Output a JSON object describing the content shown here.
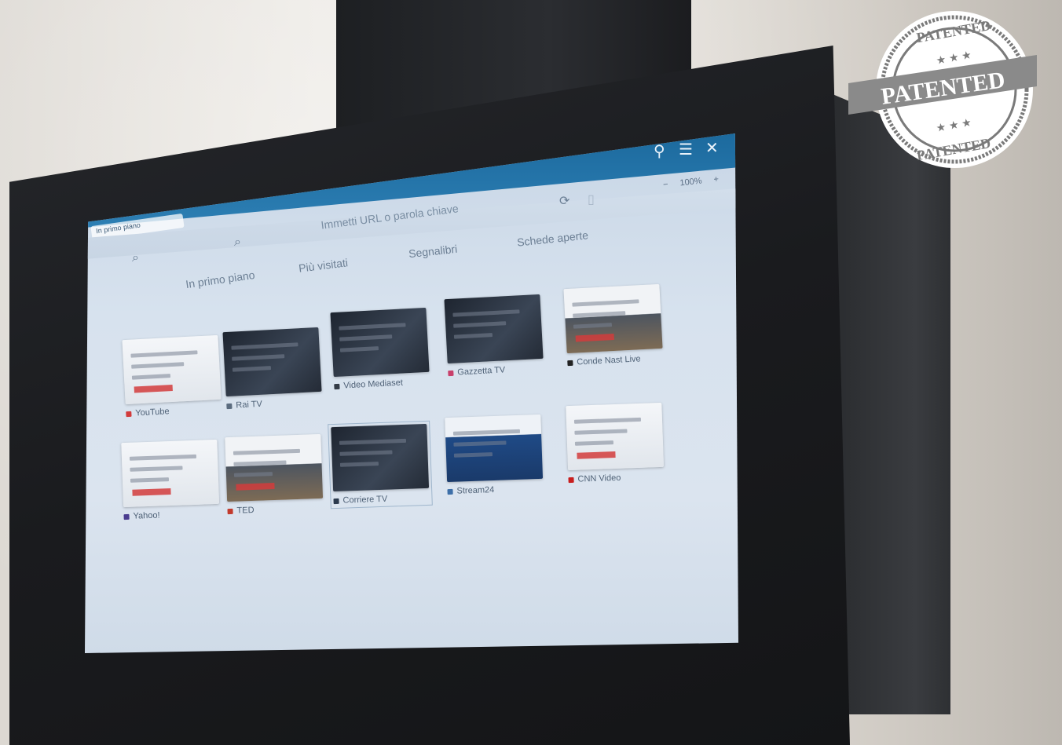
{
  "browser": {
    "active_tab": "In primo piano",
    "address_placeholder": "Immetti URL o parola chiave",
    "zoom_minus": "−",
    "zoom_level": "100%",
    "zoom_plus": "+",
    "nav_tabs": [
      "In primo piano",
      "Più visitati",
      "Segnalibri",
      "Schede aperte"
    ]
  },
  "tiles": [
    {
      "label": "YouTube",
      "color": "#d23b3b",
      "style": "light"
    },
    {
      "label": "Rai TV",
      "color": "#5b6c7f",
      "style": "dark"
    },
    {
      "label": "Video Mediaset",
      "color": "#333b46",
      "style": "dark"
    },
    {
      "label": "Gazzetta TV",
      "color": "#c8406b",
      "style": "dark"
    },
    {
      "label": "Conde Nast Live",
      "color": "#222222",
      "style": "mixed"
    },
    {
      "label": "Yahoo!",
      "color": "#4a3d8f",
      "style": "light"
    },
    {
      "label": "TED",
      "color": "#c23a2c",
      "style": "mixed"
    },
    {
      "label": "Corriere TV",
      "color": "#2b3a4e",
      "style": "dark"
    },
    {
      "label": "Stream24",
      "color": "#3d6fa8",
      "style": "blue"
    },
    {
      "label": "CNN Video",
      "color": "#c81e1e",
      "style": "light"
    }
  ],
  "badge": {
    "top": "PATENTED",
    "middle": "PATENTED",
    "bottom": "PATENTED"
  }
}
